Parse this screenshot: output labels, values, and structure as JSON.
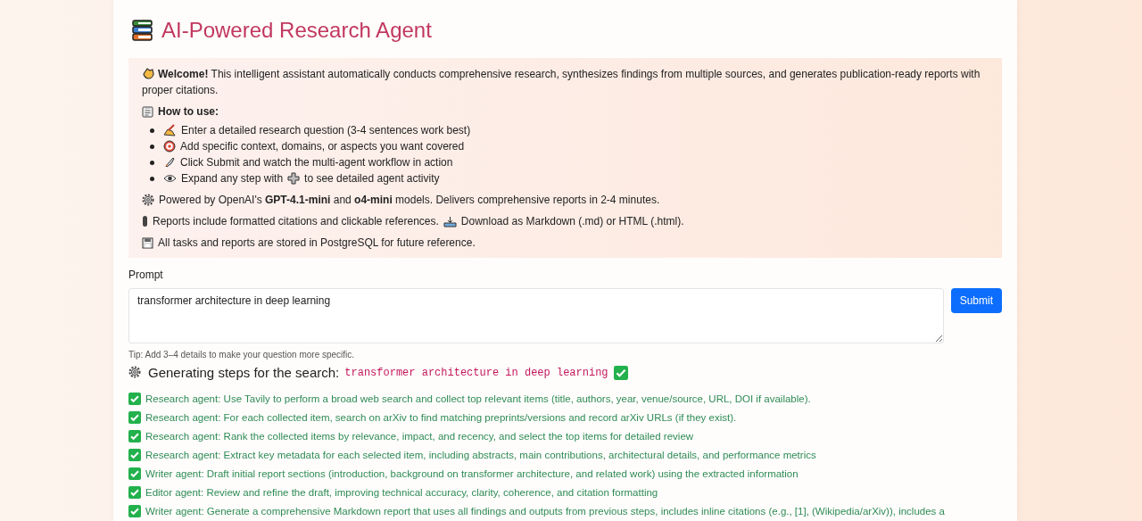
{
  "header": {
    "title": "AI-Powered Research Agent"
  },
  "info": {
    "welcome": "**Welcome!** This intelligent assistant automatically conducts comprehensive research, synthesizes findings from multiple sources, and generates publication-ready reports with proper citations.",
    "how_to_title": "How to use:",
    "how_to_items": [
      {
        "text": "Enter a detailed research question (3-4 sentences work best)"
      },
      {
        "text": "Add specific context, domains, or aspects you want covered"
      },
      {
        "text": "Click Submit and watch the multi-agent workflow in action"
      },
      {
        "before": "Expand any step with",
        "after": "to see detailed agent activity"
      }
    ],
    "powered": "Powered by OpenAI's **GPT-4.1-mini** and **o4-mini** models. Delivers comprehensive reports in 2-4 minutes.",
    "reports": "Reports include formatted citations and clickable references.",
    "download": "Download as Markdown (.md) or HTML (.html).",
    "storage": "All tasks and reports are stored in PostgreSQL for future reference."
  },
  "prompt": {
    "label": "Prompt",
    "value": "transformer architecture in deep learning",
    "submit": "Submit",
    "tip": "Tip: Add 3–4 details to make your question more specific."
  },
  "steps": {
    "heading": "Generating steps for the search:",
    "query": "transformer architecture in deep learning",
    "complete": true,
    "items": [
      {
        "text": "Research agent: Use Tavily to perform a broad web search and collect top relevant items (title, authors, year, venue/source, URL, DOI if available).",
        "done": true
      },
      {
        "text": "Research agent: For each collected item, search on arXiv to find matching preprints/versions and record arXiv URLs (if they exist).",
        "done": true
      },
      {
        "text": "Research agent: Rank the collected items by relevance, impact, and recency, and select the top items for detailed review",
        "done": true
      },
      {
        "text": "Research agent: Extract key metadata for each selected item, including abstracts, main contributions, architectural details, and performance metrics",
        "done": true
      },
      {
        "text": "Writer agent: Draft initial report sections (introduction, background on transformer architecture, and related work) using the extracted information",
        "done": true
      },
      {
        "text": "Editor agent: Review and refine the draft, improving technical accuracy, clarity, coherence, and citation formatting",
        "done": true
      },
      {
        "text": "Writer agent: Generate a comprehensive Markdown report that uses all findings and outputs from previous steps, includes inline citations (e.g., [1], (Wikipedia/arXiv)), includes a",
        "done": true
      }
    ]
  }
}
